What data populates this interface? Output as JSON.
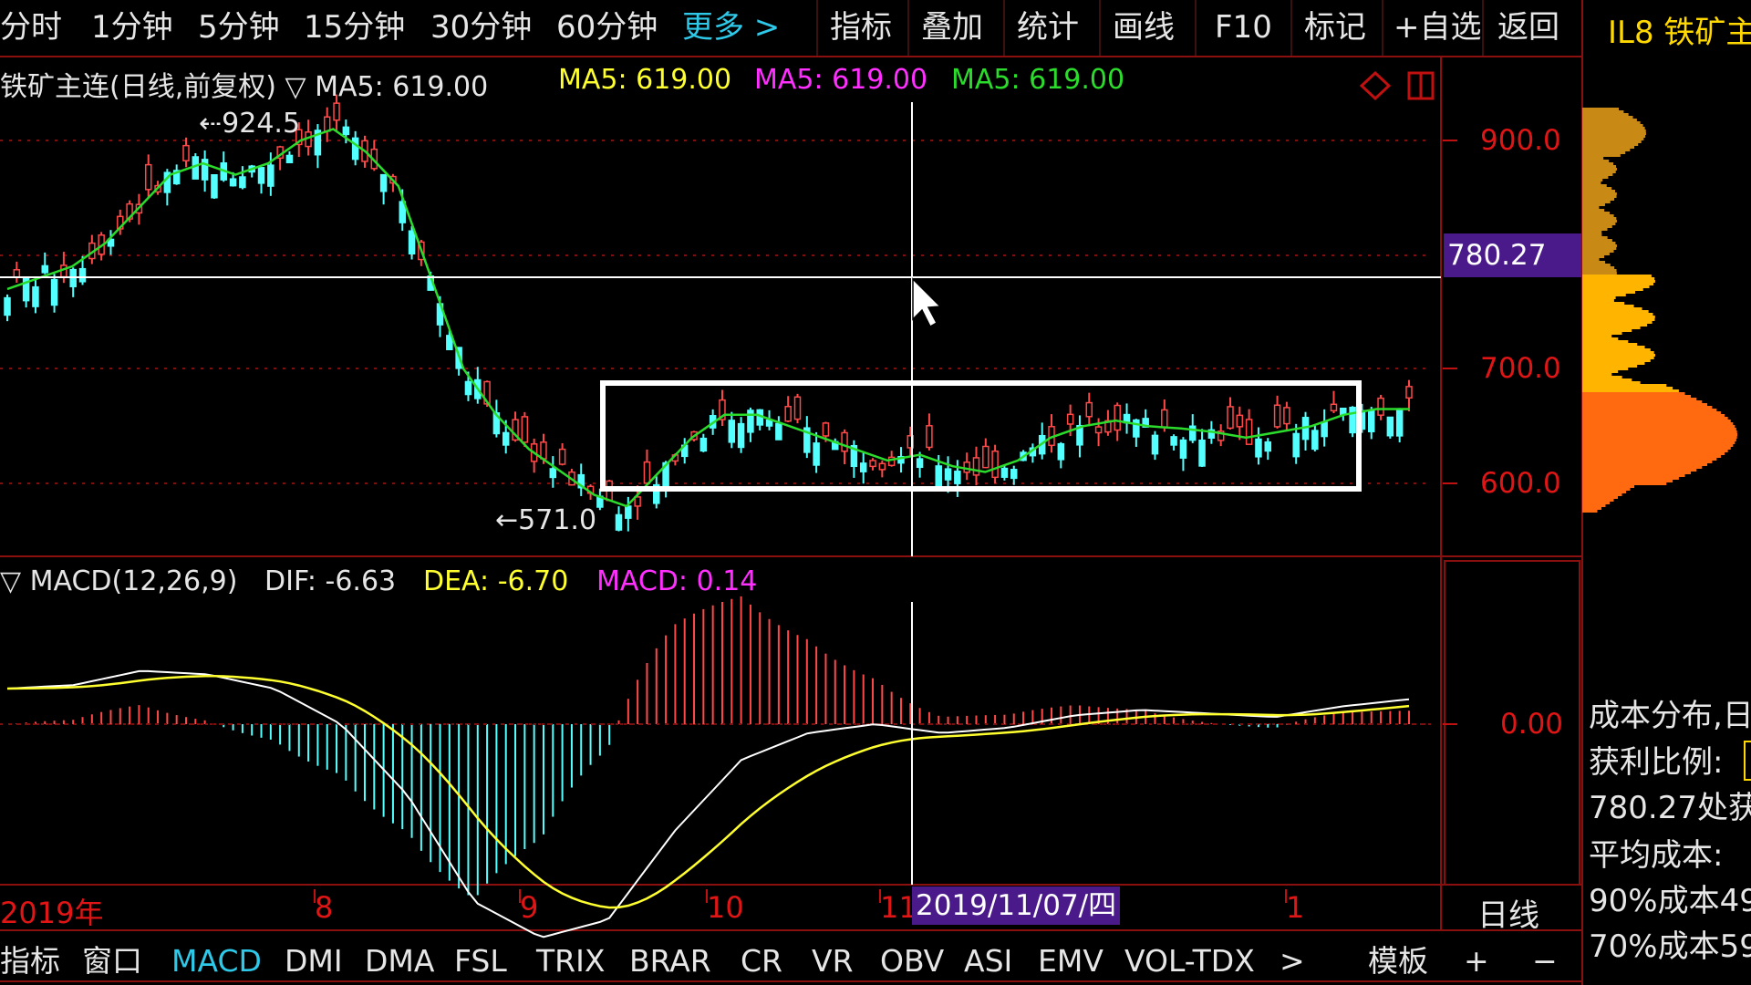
{
  "toolbar": {
    "periods": [
      "分时",
      "1分钟",
      "5分钟",
      "15分钟",
      "30分钟",
      "60分钟"
    ],
    "more": "更多 >",
    "actions": [
      "指标",
      "叠加",
      "统计",
      "画线",
      "F10",
      "标记",
      "+自选",
      "返回"
    ]
  },
  "right_title": "IL8 铁矿主",
  "main_legend": {
    "name": "铁矿主连(日线,前复权) ▽ MA5: 619.00",
    "ma_yellow": "MA5: 619.00",
    "ma_magenta": "MA5: 619.00",
    "ma_green": "MA5: 619.00"
  },
  "price_axis": [
    "900.0",
    "700.0",
    "600.0"
  ],
  "cursor_price": "780.27",
  "high_label": "924.5",
  "low_label": "571.0",
  "macd_legend": {
    "name": "▽ MACD(12,26,9)",
    "dif": "DIF: -6.63",
    "dea": "DEA: -6.70",
    "macd": "MACD: 0.14"
  },
  "macd_axis": "0.00",
  "time_axis": [
    "2019年",
    "8",
    "9",
    "10",
    "11",
    "1"
  ],
  "cursor_date": "2019/11/07/四",
  "period_label": "日线",
  "indicator_tabs": [
    "指标",
    "窗口",
    "MACD",
    "DMI",
    "DMA",
    "FSL",
    "TRIX",
    "BRAR",
    "CR",
    "VR",
    "OBV",
    "ASI",
    "EMV",
    "VOL-TDX",
    ">"
  ],
  "bottom_right": {
    "template": "模板",
    "plus": "+",
    "minus": "−"
  },
  "side_panel": {
    "line1": "成本分布,日",
    "line2": "获利比例:",
    "line3": "780.27处获",
    "line4": "平均成本:",
    "line5": "90%成本49",
    "line6": "70%成本59"
  },
  "colors": {
    "up": "#ff4848",
    "down": "#54ffff",
    "ma": "#2cdc2c",
    "axis_red": "#e01515",
    "dif": "#ffffff",
    "dea": "#ffff30",
    "macd": "#ff30ff",
    "cursor_bg": "#4a1a8a"
  },
  "chart_data": {
    "type": "candlestick",
    "title": "铁矿主连(日线,前复权)",
    "ylim": [
      560,
      940
    ],
    "annotated_high": 924.5,
    "annotated_low": 571.0,
    "ma5_approx": [
      770,
      780,
      790,
      810,
      840,
      870,
      880,
      870,
      880,
      900,
      910,
      890,
      860,
      780,
      700,
      660,
      630,
      610,
      590,
      580,
      610,
      640,
      660,
      660,
      650,
      640,
      630,
      620,
      625,
      615,
      610,
      620,
      640,
      650,
      655,
      650,
      648,
      645,
      640,
      645,
      650,
      660,
      665,
      665
    ],
    "macd_dif_approx": [
      20,
      22,
      30,
      28,
      20,
      0,
      -40,
      -100,
      -120,
      -110,
      -60,
      -20,
      -5,
      0,
      -5,
      -2,
      5,
      8,
      6,
      4,
      10,
      14
    ]
  }
}
